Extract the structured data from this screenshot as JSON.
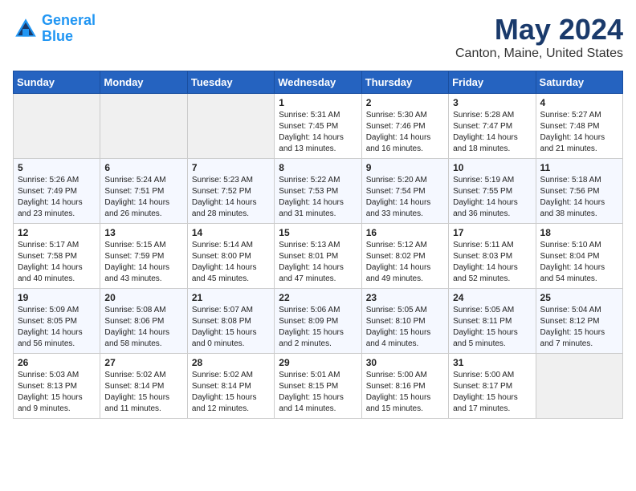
{
  "header": {
    "logo_line1": "General",
    "logo_line2": "Blue",
    "main_title": "May 2024",
    "subtitle": "Canton, Maine, United States"
  },
  "weekdays": [
    "Sunday",
    "Monday",
    "Tuesday",
    "Wednesday",
    "Thursday",
    "Friday",
    "Saturday"
  ],
  "weeks": [
    [
      {
        "day": "",
        "info": ""
      },
      {
        "day": "",
        "info": ""
      },
      {
        "day": "",
        "info": ""
      },
      {
        "day": "1",
        "info": "Sunrise: 5:31 AM\nSunset: 7:45 PM\nDaylight: 14 hours\nand 13 minutes."
      },
      {
        "day": "2",
        "info": "Sunrise: 5:30 AM\nSunset: 7:46 PM\nDaylight: 14 hours\nand 16 minutes."
      },
      {
        "day": "3",
        "info": "Sunrise: 5:28 AM\nSunset: 7:47 PM\nDaylight: 14 hours\nand 18 minutes."
      },
      {
        "day": "4",
        "info": "Sunrise: 5:27 AM\nSunset: 7:48 PM\nDaylight: 14 hours\nand 21 minutes."
      }
    ],
    [
      {
        "day": "5",
        "info": "Sunrise: 5:26 AM\nSunset: 7:49 PM\nDaylight: 14 hours\nand 23 minutes."
      },
      {
        "day": "6",
        "info": "Sunrise: 5:24 AM\nSunset: 7:51 PM\nDaylight: 14 hours\nand 26 minutes."
      },
      {
        "day": "7",
        "info": "Sunrise: 5:23 AM\nSunset: 7:52 PM\nDaylight: 14 hours\nand 28 minutes."
      },
      {
        "day": "8",
        "info": "Sunrise: 5:22 AM\nSunset: 7:53 PM\nDaylight: 14 hours\nand 31 minutes."
      },
      {
        "day": "9",
        "info": "Sunrise: 5:20 AM\nSunset: 7:54 PM\nDaylight: 14 hours\nand 33 minutes."
      },
      {
        "day": "10",
        "info": "Sunrise: 5:19 AM\nSunset: 7:55 PM\nDaylight: 14 hours\nand 36 minutes."
      },
      {
        "day": "11",
        "info": "Sunrise: 5:18 AM\nSunset: 7:56 PM\nDaylight: 14 hours\nand 38 minutes."
      }
    ],
    [
      {
        "day": "12",
        "info": "Sunrise: 5:17 AM\nSunset: 7:58 PM\nDaylight: 14 hours\nand 40 minutes."
      },
      {
        "day": "13",
        "info": "Sunrise: 5:15 AM\nSunset: 7:59 PM\nDaylight: 14 hours\nand 43 minutes."
      },
      {
        "day": "14",
        "info": "Sunrise: 5:14 AM\nSunset: 8:00 PM\nDaylight: 14 hours\nand 45 minutes."
      },
      {
        "day": "15",
        "info": "Sunrise: 5:13 AM\nSunset: 8:01 PM\nDaylight: 14 hours\nand 47 minutes."
      },
      {
        "day": "16",
        "info": "Sunrise: 5:12 AM\nSunset: 8:02 PM\nDaylight: 14 hours\nand 49 minutes."
      },
      {
        "day": "17",
        "info": "Sunrise: 5:11 AM\nSunset: 8:03 PM\nDaylight: 14 hours\nand 52 minutes."
      },
      {
        "day": "18",
        "info": "Sunrise: 5:10 AM\nSunset: 8:04 PM\nDaylight: 14 hours\nand 54 minutes."
      }
    ],
    [
      {
        "day": "19",
        "info": "Sunrise: 5:09 AM\nSunset: 8:05 PM\nDaylight: 14 hours\nand 56 minutes."
      },
      {
        "day": "20",
        "info": "Sunrise: 5:08 AM\nSunset: 8:06 PM\nDaylight: 14 hours\nand 58 minutes."
      },
      {
        "day": "21",
        "info": "Sunrise: 5:07 AM\nSunset: 8:08 PM\nDaylight: 15 hours\nand 0 minutes."
      },
      {
        "day": "22",
        "info": "Sunrise: 5:06 AM\nSunset: 8:09 PM\nDaylight: 15 hours\nand 2 minutes."
      },
      {
        "day": "23",
        "info": "Sunrise: 5:05 AM\nSunset: 8:10 PM\nDaylight: 15 hours\nand 4 minutes."
      },
      {
        "day": "24",
        "info": "Sunrise: 5:05 AM\nSunset: 8:11 PM\nDaylight: 15 hours\nand 5 minutes."
      },
      {
        "day": "25",
        "info": "Sunrise: 5:04 AM\nSunset: 8:12 PM\nDaylight: 15 hours\nand 7 minutes."
      }
    ],
    [
      {
        "day": "26",
        "info": "Sunrise: 5:03 AM\nSunset: 8:13 PM\nDaylight: 15 hours\nand 9 minutes."
      },
      {
        "day": "27",
        "info": "Sunrise: 5:02 AM\nSunset: 8:14 PM\nDaylight: 15 hours\nand 11 minutes."
      },
      {
        "day": "28",
        "info": "Sunrise: 5:02 AM\nSunset: 8:14 PM\nDaylight: 15 hours\nand 12 minutes."
      },
      {
        "day": "29",
        "info": "Sunrise: 5:01 AM\nSunset: 8:15 PM\nDaylight: 15 hours\nand 14 minutes."
      },
      {
        "day": "30",
        "info": "Sunrise: 5:00 AM\nSunset: 8:16 PM\nDaylight: 15 hours\nand 15 minutes."
      },
      {
        "day": "31",
        "info": "Sunrise: 5:00 AM\nSunset: 8:17 PM\nDaylight: 15 hours\nand 17 minutes."
      },
      {
        "day": "",
        "info": ""
      }
    ]
  ]
}
